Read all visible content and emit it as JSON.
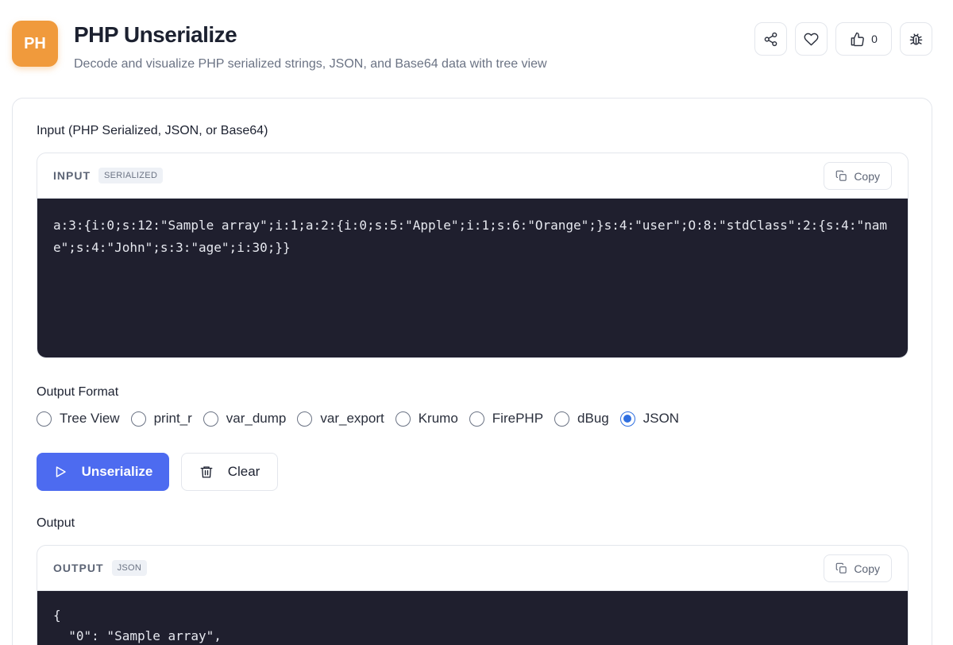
{
  "app": {
    "logo_text": "PH",
    "title": "PHP Unserialize",
    "subtitle": "Decode and visualize PHP serialized strings, JSON, and Base64 data with tree view"
  },
  "header_actions": {
    "like_count": "0",
    "icons": [
      "share-icon",
      "heart-icon",
      "thumbs-up-icon",
      "bug-icon"
    ]
  },
  "input_section": {
    "label": "Input (PHP Serialized, JSON, or Base64)",
    "panel_title": "INPUT",
    "badge": "SERIALIZED",
    "copy_label": "Copy",
    "value": "a:3:{i:0;s:12:\"Sample array\";i:1;a:2:{i:0;s:5:\"Apple\";i:1;s:6:\"Orange\";}s:4:\"user\";O:8:\"stdClass\":2:{s:4:\"name\";s:4:\"John\";s:3:\"age\";i:30;}}"
  },
  "output_format": {
    "label": "Output Format",
    "options": [
      "Tree View",
      "print_r",
      "var_dump",
      "var_export",
      "Krumo",
      "FirePHP",
      "dBug",
      "JSON"
    ],
    "selected": "JSON"
  },
  "actions": {
    "unserialize_label": "Unserialize",
    "clear_label": "Clear"
  },
  "output_section": {
    "label": "Output",
    "panel_title": "OUTPUT",
    "badge": "JSON",
    "copy_label": "Copy",
    "value": "{\n  \"0\": \"Sample array\","
  },
  "colors": {
    "logo": "#f09a3c",
    "primary": "#4d6bf0",
    "code_bg": "#1f1f2e",
    "radio_selected": "#2f6fe0"
  }
}
